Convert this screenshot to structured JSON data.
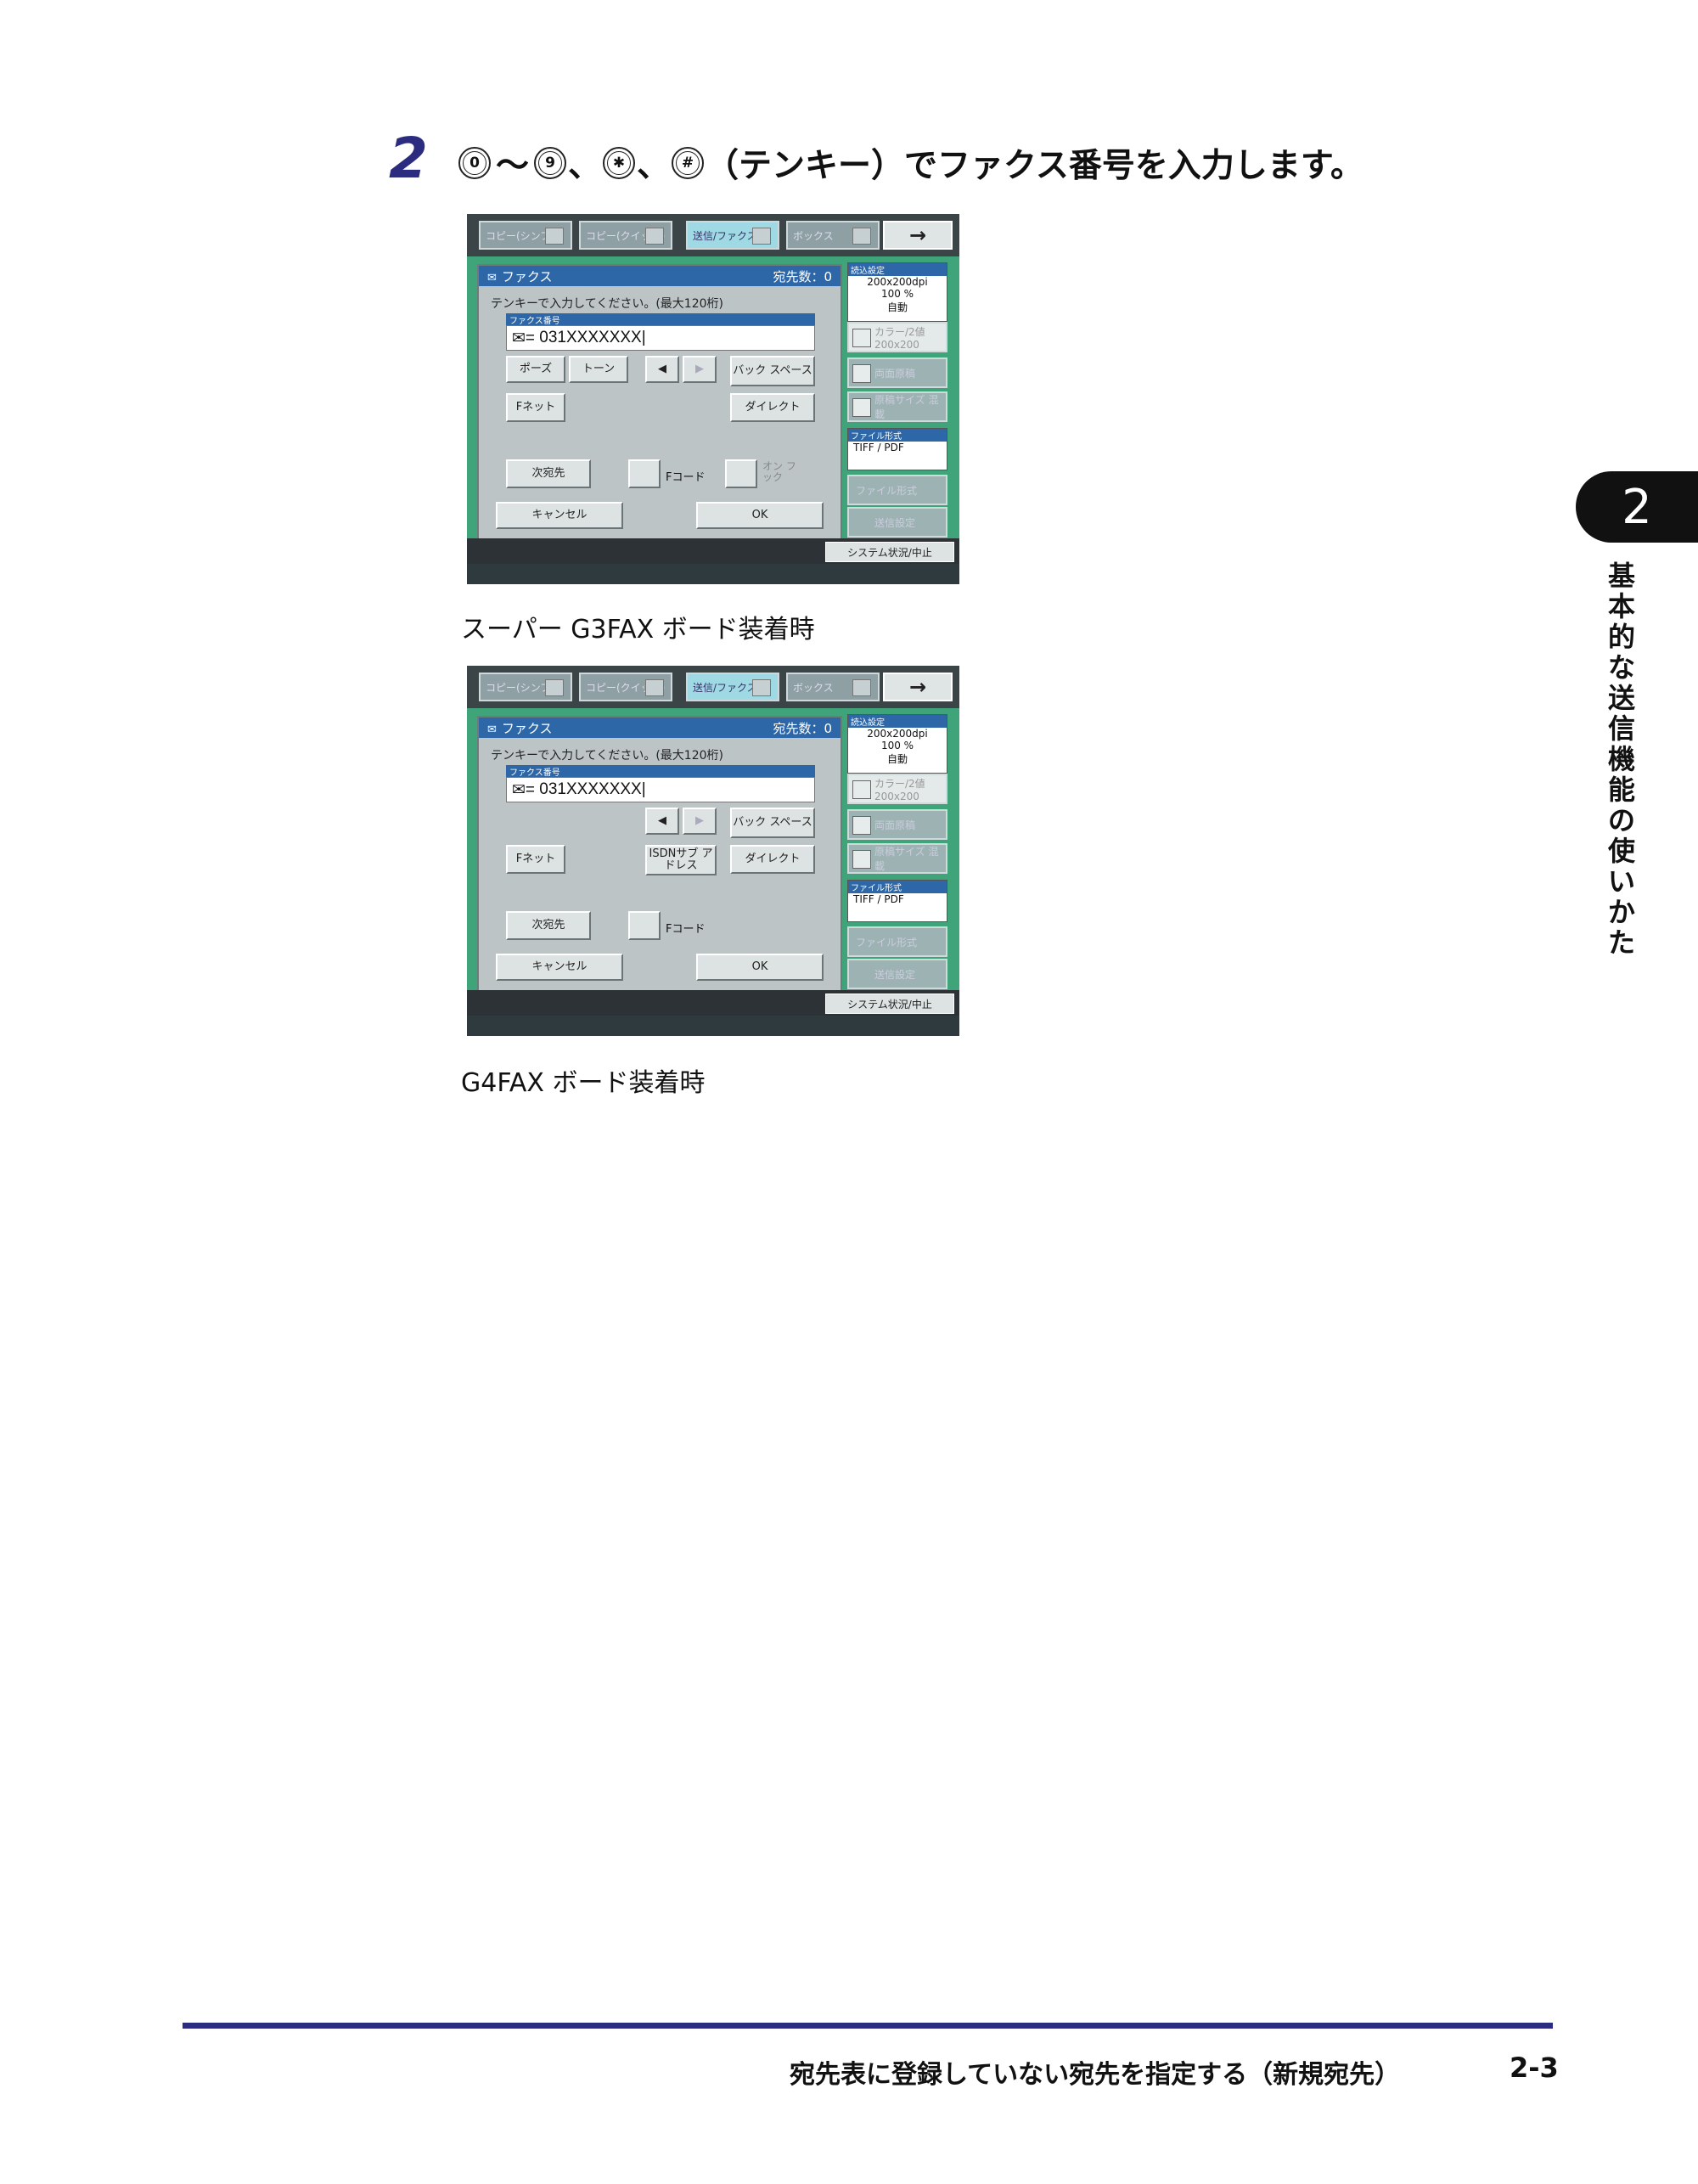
{
  "step": {
    "number": "2",
    "keys": [
      "0",
      "9",
      "✱",
      "#"
    ],
    "tilde": "〜",
    "sep1": "、",
    "sep2": "、",
    "text": "（テンキー）でファクス番号を入力します。"
  },
  "screens": [
    {
      "caption": "スーパー G3FAX ボード装着時",
      "tabs": [
        "コピー(シンプル)",
        "コピー(クイック)",
        "送信/ファクス",
        "ボックス"
      ],
      "arrow": "→",
      "panel_title": "ファクス",
      "dest_count": "宛先数：0",
      "instruction": "テンキーで入力してください。(最大120桁)",
      "field_label": "ファクス番号",
      "field_value": "031XXXXXXX",
      "buttons": {
        "pause": "ポーズ",
        "tone": "トーン",
        "left": "◀",
        "right": "▶",
        "backspace": "バック スペース",
        "fnet": "Fネット",
        "direct": "ダイレクト",
        "next_dest": "次宛先",
        "fcode": "Fコード",
        "onhook": "オン フック",
        "cancel": "キャンセル",
        "ok": "OK"
      },
      "side": {
        "scan_header": "読込設定",
        "resolution": "200x200dpi",
        "zoom": "100 %",
        "auto": "自動",
        "color": "カラー/2値 200x200",
        "duplex": "両面原稿",
        "size": "原稿サイズ 混載",
        "file_header": "ファイル形式",
        "file_format": "TIFF / PDF",
        "file_btn": "ファイル形式",
        "send_btn": "送信設定"
      },
      "system": "システム状況/中止"
    },
    {
      "caption": "G4FAX ボード装着時",
      "tabs": [
        "コピー(シンプル)",
        "コピー(クイック)",
        "送信/ファクス",
        "ボックス"
      ],
      "arrow": "→",
      "panel_title": "ファクス",
      "dest_count": "宛先数：0",
      "instruction": "テンキーで入力してください。(最大120桁)",
      "field_label": "ファクス番号",
      "field_value": "031XXXXXXX",
      "buttons": {
        "left": "◀",
        "right": "▶",
        "backspace": "バック スペース",
        "fnet": "Fネット",
        "isdn": "ISDNサブ アドレス",
        "direct": "ダイレクト",
        "next_dest": "次宛先",
        "fcode": "Fコード",
        "cancel": "キャンセル",
        "ok": "OK"
      },
      "side": {
        "scan_header": "読込設定",
        "resolution": "200x200dpi",
        "zoom": "100 %",
        "auto": "自動",
        "color": "カラー/2値 200x200",
        "duplex": "両面原稿",
        "size": "原稿サイズ 混載",
        "file_header": "ファイル形式",
        "file_format": "TIFF / PDF",
        "file_btn": "ファイル形式",
        "send_btn": "送信設定"
      },
      "system": "システム状況/中止"
    }
  ],
  "chapter": {
    "number": "2",
    "title": "基本的な送信機能の使いかた"
  },
  "footer": {
    "title": "宛先表に登録していない宛先を指定する（新規宛先）",
    "page": "2-3"
  },
  "colors": {
    "accent": "#2b2b80",
    "screen_green": "#3fa479",
    "panel_blue": "#2d67a8"
  }
}
